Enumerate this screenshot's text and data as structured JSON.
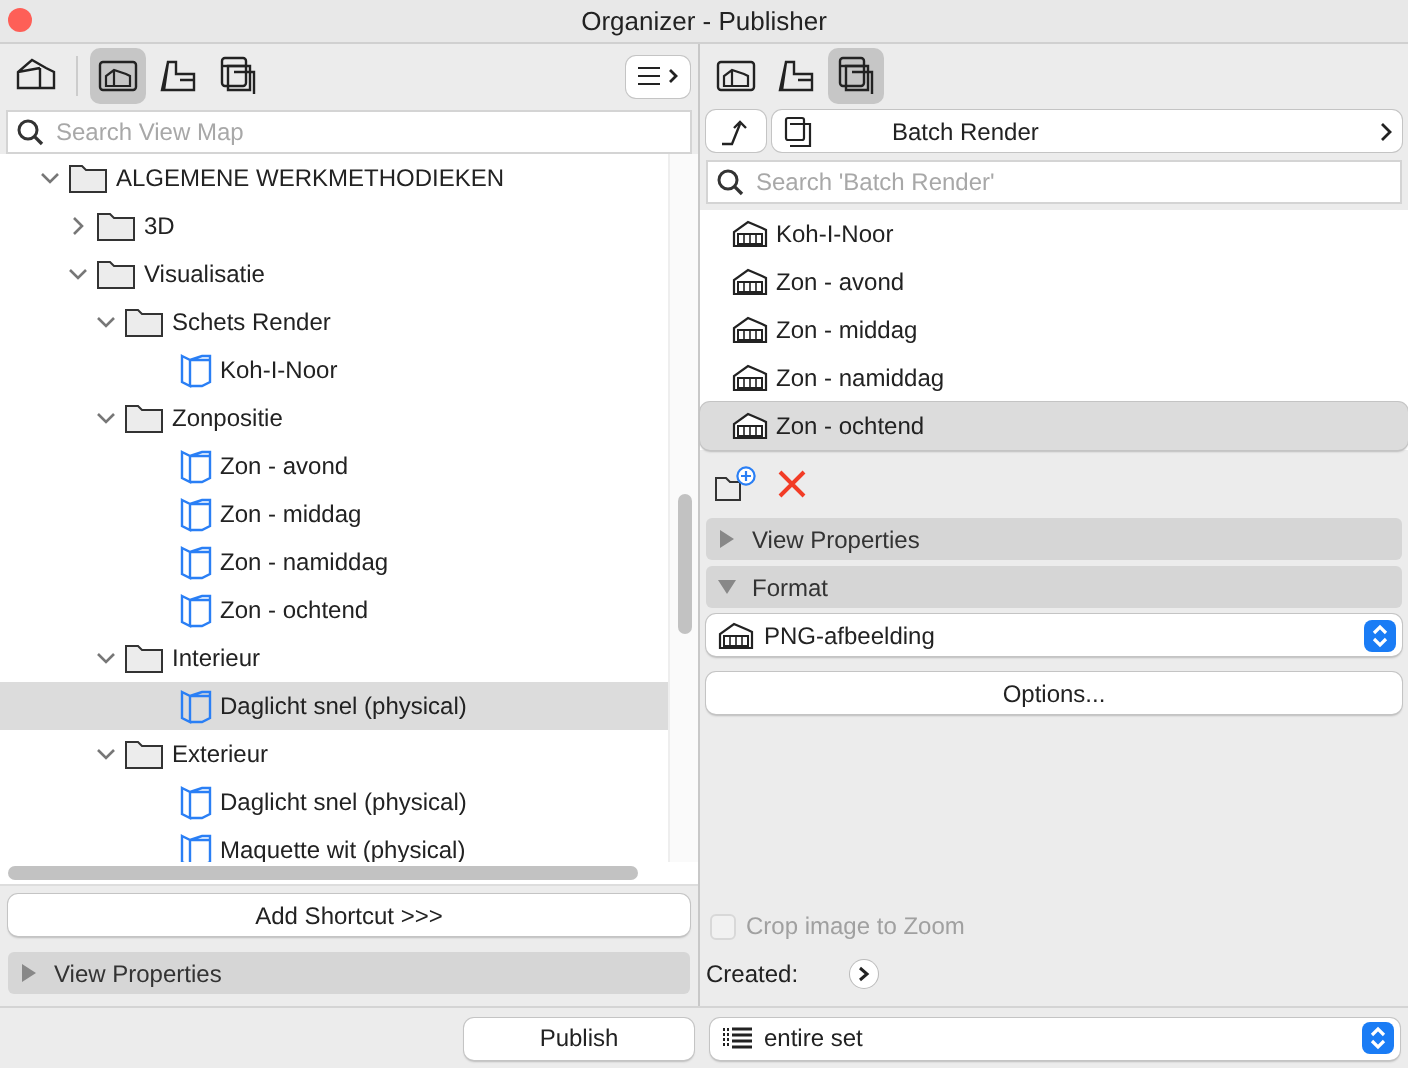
{
  "window": {
    "title": "Organizer - Publisher"
  },
  "left": {
    "toolbar": [
      {
        "kind": "project",
        "selected": false
      },
      {
        "kind": "view",
        "selected": true
      },
      {
        "kind": "layout",
        "selected": false
      },
      {
        "kind": "publisher",
        "selected": false
      }
    ],
    "search": {
      "placeholder": "Search View Map"
    },
    "tree": [
      {
        "kind": "folder",
        "label": "ALGEMENE WERKMETHODIEKEN",
        "expanded": true,
        "selected": false,
        "children": [
          {
            "kind": "folder",
            "label": "3D",
            "expanded": false,
            "selected": false
          },
          {
            "kind": "folder",
            "label": "Visualisatie",
            "expanded": true,
            "selected": false,
            "children": [
              {
                "kind": "folder",
                "label": "Schets Render",
                "expanded": true,
                "selected": false,
                "children": [
                  {
                    "kind": "view",
                    "label": "Koh-I-Noor",
                    "selected": false
                  }
                ]
              },
              {
                "kind": "folder",
                "label": "Zonpositie",
                "expanded": true,
                "selected": false,
                "children": [
                  {
                    "kind": "view",
                    "label": "Zon - avond",
                    "selected": false
                  },
                  {
                    "kind": "view",
                    "label": "Zon - middag",
                    "selected": false
                  },
                  {
                    "kind": "view",
                    "label": "Zon - namiddag",
                    "selected": false
                  },
                  {
                    "kind": "view",
                    "label": "Zon - ochtend",
                    "selected": false
                  }
                ]
              },
              {
                "kind": "folder",
                "label": "Interieur",
                "expanded": true,
                "selected": false,
                "children": [
                  {
                    "kind": "view",
                    "label": "Daglicht snel (physical)",
                    "selected": true
                  }
                ]
              },
              {
                "kind": "folder",
                "label": "Exterieur",
                "expanded": true,
                "selected": false,
                "children": [
                  {
                    "kind": "view",
                    "label": "Daglicht snel (physical)",
                    "selected": false
                  },
                  {
                    "kind": "view",
                    "label": "Maquette wit (physical)",
                    "selected": false
                  }
                ]
              }
            ]
          }
        ]
      }
    ],
    "add_shortcut": "Add Shortcut >>>",
    "view_properties": {
      "label": "View Properties",
      "expanded": false
    }
  },
  "right": {
    "toolbar": [
      {
        "kind": "view",
        "selected": false
      },
      {
        "kind": "layout",
        "selected": false
      },
      {
        "kind": "publisher",
        "selected": true
      }
    ],
    "breadcrumb": {
      "label": "Batch Render"
    },
    "search": {
      "placeholder": "Search 'Batch Render'"
    },
    "items": [
      {
        "label": "Koh-I-Noor",
        "selected": false
      },
      {
        "label": "Zon - avond",
        "selected": false
      },
      {
        "label": "Zon - middag",
        "selected": false
      },
      {
        "label": "Zon - namiddag",
        "selected": false
      },
      {
        "label": "Zon - ochtend",
        "selected": true
      }
    ],
    "sections": [
      {
        "label": "View Properties",
        "expanded": false
      },
      {
        "label": "Format",
        "expanded": true
      }
    ],
    "format": {
      "value": "PNG-afbeelding"
    },
    "options_button": "Options...",
    "crop": {
      "label": "Crop image to Zoom",
      "checked": false,
      "disabled": true
    },
    "created_label": "Created:"
  },
  "footer": {
    "publish": "Publish",
    "scope": {
      "value": "entire set"
    }
  }
}
